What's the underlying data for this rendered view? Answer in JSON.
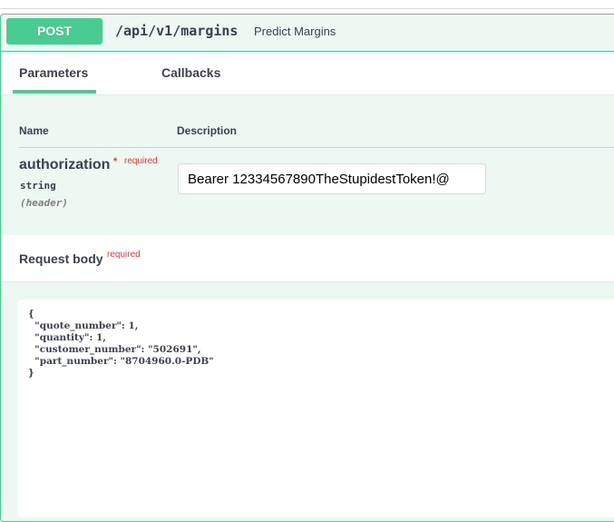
{
  "operation": {
    "method": "POST",
    "path": "/api/v1/margins",
    "summary": "Predict Margins",
    "method_color": "#49cc90"
  },
  "tabs": [
    {
      "label": "Parameters",
      "active": true
    },
    {
      "label": "Callbacks",
      "active": false
    }
  ],
  "parameters": {
    "headers": {
      "name": "Name",
      "description": "Description"
    },
    "items": [
      {
        "name": "authorization",
        "required_star": "*",
        "required_label": "required",
        "type": "string",
        "in": "(header)",
        "value": "Bearer 12334567890TheStupidestToken!@"
      }
    ]
  },
  "request_body": {
    "title": "Request body",
    "required_label": "required",
    "value": "{\n  \"quote_number\": 1,\n  \"quantity\": 1,\n  \"customer_number\": \"502691\",\n  \"part_number\": \"8704960.0-PDB\"\n}"
  }
}
